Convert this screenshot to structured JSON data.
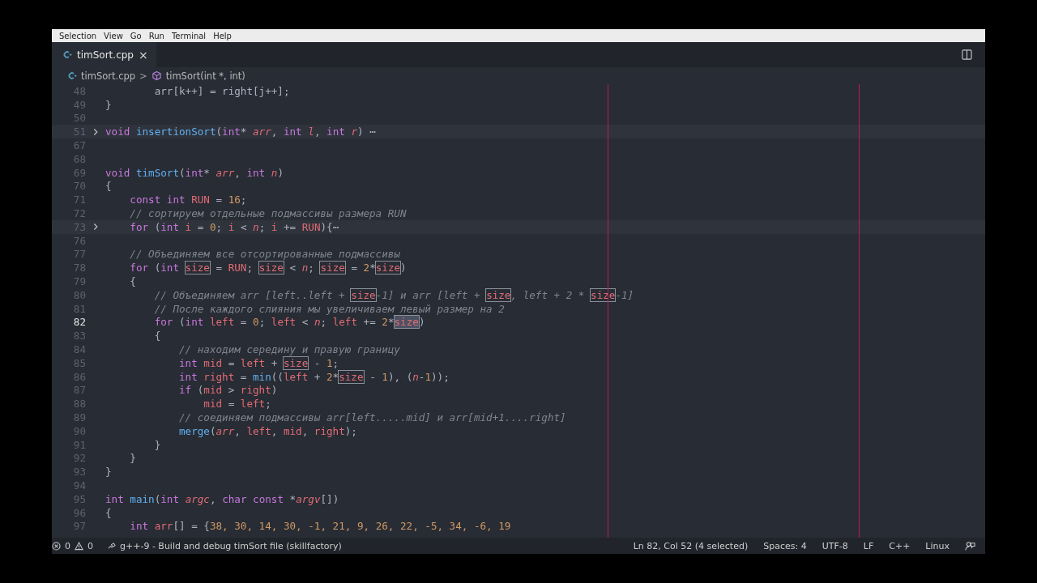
{
  "menu": [
    "Selection",
    "View",
    "Go",
    "Run",
    "Terminal",
    "Help"
  ],
  "tab": {
    "label": "timSort.cpp",
    "selected": true,
    "close": "×"
  },
  "breadcrumbs": {
    "file": "timSort.cpp",
    "separator": ">",
    "symbol": "timSort(int *, int)"
  },
  "lines": [
    {
      "num": "48",
      "tokens": [
        {
          "kind": "punctuation",
          "text": "        arr[k++] = right[j++];"
        }
      ]
    },
    {
      "num": "49",
      "tokens": [
        {
          "kind": "punctuation",
          "text": "}"
        }
      ]
    },
    {
      "num": "50"
    },
    {
      "num": "51",
      "folded": true,
      "tokens": [
        {
          "kind": "keyword",
          "text": "void "
        },
        {
          "kind": "function",
          "text": "insertionSort"
        },
        {
          "kind": "punctuation",
          "text": "("
        },
        {
          "kind": "keyword",
          "text": "int"
        },
        {
          "kind": "punctuation",
          "text": "* "
        },
        {
          "kind": "parameter",
          "text": "arr"
        },
        {
          "kind": "punctuation",
          "text": ", "
        },
        {
          "kind": "keyword",
          "text": "int "
        },
        {
          "kind": "parameter",
          "text": "l"
        },
        {
          "kind": "punctuation",
          "text": ", "
        },
        {
          "kind": "keyword",
          "text": "int "
        },
        {
          "kind": "parameter",
          "text": "r"
        },
        {
          "kind": "punctuation",
          "text": ") "
        },
        {
          "kind": "ellipsis",
          "text": "⋯"
        }
      ]
    },
    {
      "num": "67"
    },
    {
      "num": "68"
    },
    {
      "num": "69",
      "tokens": [
        {
          "kind": "keyword",
          "text": "void "
        },
        {
          "kind": "function",
          "text": "timSort"
        },
        {
          "kind": "punctuation",
          "text": "("
        },
        {
          "kind": "keyword",
          "text": "int"
        },
        {
          "kind": "punctuation",
          "text": "* "
        },
        {
          "kind": "parameter",
          "text": "arr"
        },
        {
          "kind": "punctuation",
          "text": ", "
        },
        {
          "kind": "keyword",
          "text": "int "
        },
        {
          "kind": "parameter",
          "text": "n"
        },
        {
          "kind": "punctuation",
          "text": ")"
        }
      ]
    },
    {
      "num": "70",
      "tokens": [
        {
          "kind": "punctuation",
          "text": "{"
        }
      ]
    },
    {
      "num": "71",
      "tokens": [
        {
          "kind": "keyword",
          "text": "    const int "
        },
        {
          "kind": "variable",
          "text": "RUN"
        },
        {
          "kind": "punctuation",
          "text": " = "
        },
        {
          "kind": "number",
          "text": "16"
        },
        {
          "kind": "punctuation",
          "text": ";"
        }
      ]
    },
    {
      "num": "72",
      "tokens": [
        {
          "kind": "comment",
          "text": "    // сортируем отдельные подмассивы размера RUN"
        }
      ]
    },
    {
      "num": "73",
      "folded": true,
      "tokens": [
        {
          "kind": "keyword",
          "text": "    for "
        },
        {
          "kind": "punctuation",
          "text": "("
        },
        {
          "kind": "keyword",
          "text": "int "
        },
        {
          "kind": "variable",
          "text": "i"
        },
        {
          "kind": "punctuation",
          "text": " = "
        },
        {
          "kind": "number",
          "text": "0"
        },
        {
          "kind": "punctuation",
          "text": "; "
        },
        {
          "kind": "variable",
          "text": "i"
        },
        {
          "kind": "punctuation",
          "text": " < "
        },
        {
          "kind": "parameter",
          "text": "n"
        },
        {
          "kind": "punctuation",
          "text": "; "
        },
        {
          "kind": "variable",
          "text": "i"
        },
        {
          "kind": "punctuation",
          "text": " += "
        },
        {
          "kind": "variable",
          "text": "RUN"
        },
        {
          "kind": "punctuation",
          "text": "){"
        },
        {
          "kind": "ellipsis",
          "text": "⋯"
        }
      ]
    },
    {
      "num": "76"
    },
    {
      "num": "77",
      "tokens": [
        {
          "kind": "comment",
          "text": "    // Объединяем все отсортированные подмассивы"
        }
      ]
    },
    {
      "num": "78",
      "tokens": [
        {
          "kind": "keyword",
          "text": "    for "
        },
        {
          "kind": "punctuation",
          "text": "("
        },
        {
          "kind": "keyword",
          "text": "int "
        },
        {
          "kind": "match",
          "text": "size"
        },
        {
          "kind": "punctuation",
          "text": " = "
        },
        {
          "kind": "variable",
          "text": "RUN"
        },
        {
          "kind": "punctuation",
          "text": "; "
        },
        {
          "kind": "match",
          "text": "size"
        },
        {
          "kind": "punctuation",
          "text": " < "
        },
        {
          "kind": "parameter",
          "text": "n"
        },
        {
          "kind": "punctuation",
          "text": "; "
        },
        {
          "kind": "match",
          "text": "size"
        },
        {
          "kind": "punctuation",
          "text": " = "
        },
        {
          "kind": "number",
          "text": "2"
        },
        {
          "kind": "punctuation",
          "text": "*"
        },
        {
          "kind": "match",
          "text": "size"
        },
        {
          "kind": "punctuation",
          "text": ")"
        }
      ]
    },
    {
      "num": "79",
      "tokens": [
        {
          "kind": "punctuation",
          "text": "    {"
        }
      ]
    },
    {
      "num": "80",
      "tokens": [
        {
          "kind": "comment",
          "text": "        // Объединяем arr [left..left + "
        },
        {
          "kind": "match",
          "text": "size"
        },
        {
          "kind": "comment",
          "text": "-1] и arr [left + "
        },
        {
          "kind": "match",
          "text": "size"
        },
        {
          "kind": "comment",
          "text": ", left + 2 * "
        },
        {
          "kind": "match",
          "text": "size"
        },
        {
          "kind": "comment",
          "text": "-1]"
        }
      ]
    },
    {
      "num": "81",
      "tokens": [
        {
          "kind": "comment",
          "text": "        // После каждого слияния мы увеличиваем левый размер на 2"
        }
      ]
    },
    {
      "num": "82",
      "current": true,
      "tokens": [
        {
          "kind": "keyword",
          "text": "        for "
        },
        {
          "kind": "punctuation",
          "text": "("
        },
        {
          "kind": "keyword",
          "text": "int "
        },
        {
          "kind": "variable",
          "text": "left"
        },
        {
          "kind": "punctuation",
          "text": " = "
        },
        {
          "kind": "number",
          "text": "0"
        },
        {
          "kind": "punctuation",
          "text": "; "
        },
        {
          "kind": "variable",
          "text": "left"
        },
        {
          "kind": "punctuation",
          "text": " < "
        },
        {
          "kind": "parameter",
          "text": "n"
        },
        {
          "kind": "punctuation",
          "text": "; "
        },
        {
          "kind": "variable",
          "text": "left"
        },
        {
          "kind": "punctuation",
          "text": " += "
        },
        {
          "kind": "number",
          "text": "2"
        },
        {
          "kind": "punctuation",
          "text": "*"
        },
        {
          "kind": "selection",
          "text": "size"
        },
        {
          "kind": "punctuation",
          "text": ")"
        }
      ]
    },
    {
      "num": "83",
      "tokens": [
        {
          "kind": "punctuation",
          "text": "        {"
        }
      ]
    },
    {
      "num": "84",
      "tokens": [
        {
          "kind": "comment",
          "text": "            // находим середину и правую границу"
        }
      ]
    },
    {
      "num": "85",
      "tokens": [
        {
          "kind": "keyword",
          "text": "            int "
        },
        {
          "kind": "variable",
          "text": "mid"
        },
        {
          "kind": "punctuation",
          "text": " = "
        },
        {
          "kind": "variable",
          "text": "left"
        },
        {
          "kind": "punctuation",
          "text": " + "
        },
        {
          "kind": "match",
          "text": "size"
        },
        {
          "kind": "punctuation",
          "text": " - "
        },
        {
          "kind": "number",
          "text": "1"
        },
        {
          "kind": "punctuation",
          "text": ";"
        }
      ]
    },
    {
      "num": "86",
      "tokens": [
        {
          "kind": "keyword",
          "text": "            int "
        },
        {
          "kind": "variable",
          "text": "right"
        },
        {
          "kind": "punctuation",
          "text": " = "
        },
        {
          "kind": "function",
          "text": "min"
        },
        {
          "kind": "punctuation",
          "text": "(("
        },
        {
          "kind": "variable",
          "text": "left"
        },
        {
          "kind": "punctuation",
          "text": " + "
        },
        {
          "kind": "number",
          "text": "2"
        },
        {
          "kind": "punctuation",
          "text": "*"
        },
        {
          "kind": "match",
          "text": "size"
        },
        {
          "kind": "punctuation",
          "text": " - "
        },
        {
          "kind": "number",
          "text": "1"
        },
        {
          "kind": "punctuation",
          "text": "), ("
        },
        {
          "kind": "parameter",
          "text": "n"
        },
        {
          "kind": "punctuation",
          "text": "-"
        },
        {
          "kind": "number",
          "text": "1"
        },
        {
          "kind": "punctuation",
          "text": "));"
        }
      ]
    },
    {
      "num": "87",
      "tokens": [
        {
          "kind": "keyword",
          "text": "            if "
        },
        {
          "kind": "punctuation",
          "text": "("
        },
        {
          "kind": "variable",
          "text": "mid"
        },
        {
          "kind": "punctuation",
          "text": " > "
        },
        {
          "kind": "variable",
          "text": "right"
        },
        {
          "kind": "punctuation",
          "text": ")"
        }
      ]
    },
    {
      "num": "88",
      "tokens": [
        {
          "kind": "variable",
          "text": "                mid"
        },
        {
          "kind": "punctuation",
          "text": " = "
        },
        {
          "kind": "variable",
          "text": "left"
        },
        {
          "kind": "punctuation",
          "text": ";"
        }
      ]
    },
    {
      "num": "89",
      "tokens": [
        {
          "kind": "comment",
          "text": "            // соединяем подмассивы arr[left.....mid] и arr[mid+1....right]"
        }
      ]
    },
    {
      "num": "90",
      "tokens": [
        {
          "kind": "function",
          "text": "            merge"
        },
        {
          "kind": "punctuation",
          "text": "("
        },
        {
          "kind": "parameter",
          "text": "arr"
        },
        {
          "kind": "punctuation",
          "text": ", "
        },
        {
          "kind": "variable",
          "text": "left"
        },
        {
          "kind": "punctuation",
          "text": ", "
        },
        {
          "kind": "variable",
          "text": "mid"
        },
        {
          "kind": "punctuation",
          "text": ", "
        },
        {
          "kind": "variable",
          "text": "right"
        },
        {
          "kind": "punctuation",
          "text": ");"
        }
      ]
    },
    {
      "num": "91",
      "tokens": [
        {
          "kind": "punctuation",
          "text": "        }"
        }
      ]
    },
    {
      "num": "92",
      "tokens": [
        {
          "kind": "punctuation",
          "text": "    }"
        }
      ]
    },
    {
      "num": "93",
      "tokens": [
        {
          "kind": "punctuation",
          "text": "}"
        }
      ]
    },
    {
      "num": "94"
    },
    {
      "num": "95",
      "tokens": [
        {
          "kind": "keyword",
          "text": "int "
        },
        {
          "kind": "function",
          "text": "main"
        },
        {
          "kind": "punctuation",
          "text": "("
        },
        {
          "kind": "keyword",
          "text": "int "
        },
        {
          "kind": "parameter",
          "text": "argc"
        },
        {
          "kind": "punctuation",
          "text": ", "
        },
        {
          "kind": "keyword",
          "text": "char const "
        },
        {
          "kind": "punctuation",
          "text": "*"
        },
        {
          "kind": "parameter",
          "text": "argv"
        },
        {
          "kind": "punctuation",
          "text": "[])"
        }
      ]
    },
    {
      "num": "96",
      "tokens": [
        {
          "kind": "punctuation",
          "text": "{"
        }
      ]
    },
    {
      "num": "97",
      "tokens": [
        {
          "kind": "keyword",
          "text": "    int "
        },
        {
          "kind": "variable",
          "text": "arr"
        },
        {
          "kind": "punctuation",
          "text": "[] = {"
        },
        {
          "kind": "number",
          "text": "38, 30, 14, 30, -1, 21, 9, 26, 22, -5, 34, -6, 19"
        }
      ]
    }
  ],
  "status": {
    "errors": "0",
    "warnings": "0",
    "task": "g++-9 - Build and debug timSort file (skillfactory)",
    "right": [
      "Ln 82, Col 52 (4 selected)",
      "Spaces: 4",
      "UTF-8",
      "LF",
      "C++",
      "Linux"
    ]
  }
}
